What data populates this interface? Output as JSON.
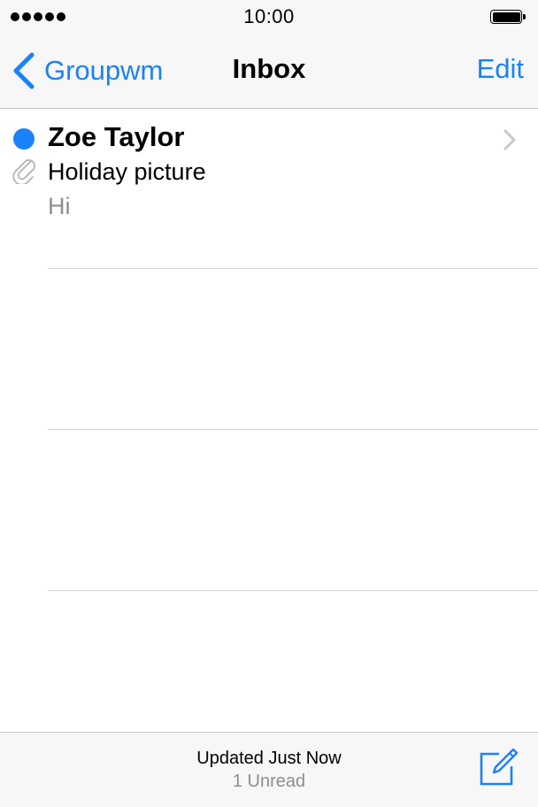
{
  "status_bar": {
    "time": "10:00",
    "signal_icon": "signal-dots-icon",
    "battery_icon": "battery-full-icon",
    "battery_level": 1.0
  },
  "nav": {
    "back_label": "Groupwm",
    "title": "Inbox",
    "edit_label": "Edit"
  },
  "messages": [
    {
      "sender": "Zoe Taylor",
      "subject": "Holiday picture",
      "preview": "Hi",
      "unread": true,
      "has_attachment": true
    }
  ],
  "toolbar": {
    "status": "Updated Just Now",
    "unread_count": "1 Unread",
    "compose_icon": "compose-icon"
  },
  "colors": {
    "accent": "#1a82f7",
    "secondary_text": "#8e8e93",
    "bar_background": "#f7f7f7",
    "separator": "#d6d6da"
  }
}
